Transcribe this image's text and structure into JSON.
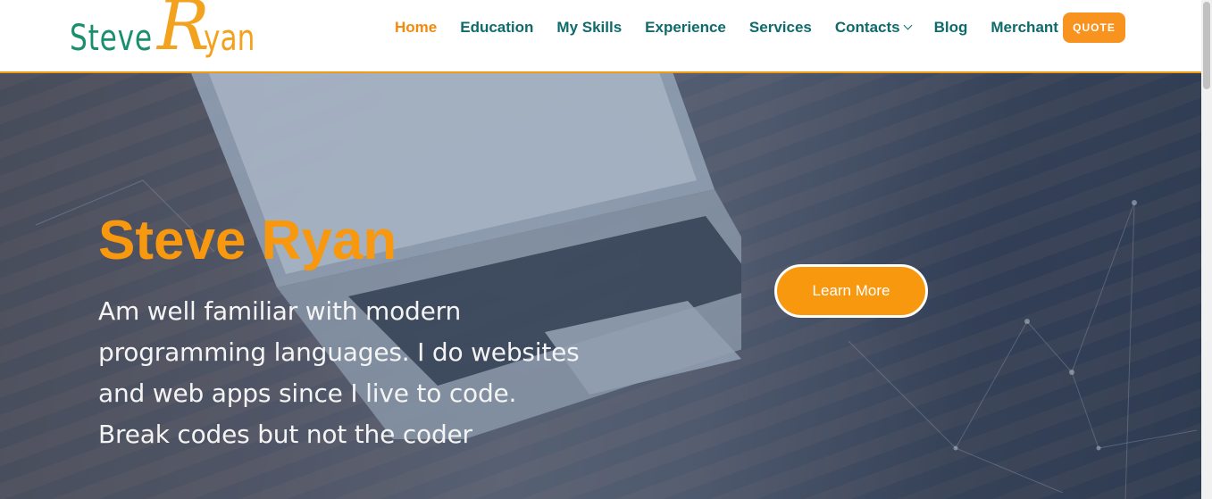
{
  "logo": {
    "first": "Steve",
    "r": "R",
    "rest": "yan"
  },
  "nav": {
    "items": [
      {
        "label": "Home",
        "active": true
      },
      {
        "label": "Education"
      },
      {
        "label": "My Skills"
      },
      {
        "label": "Experience"
      },
      {
        "label": "Services"
      },
      {
        "label": "Contacts",
        "dropdown": true
      },
      {
        "label": "Blog"
      },
      {
        "label": "Merchant"
      }
    ],
    "quote_label": "QUOTE"
  },
  "hero": {
    "title": "Steve Ryan",
    "text": "Am well familiar with modern programming languages. I do websites and web apps since I live to code. Break codes but not the coder",
    "button": "Learn More"
  },
  "colors": {
    "accent": "#f7980f",
    "nav": "#0f6b6b",
    "header_border": "#f39c12"
  }
}
